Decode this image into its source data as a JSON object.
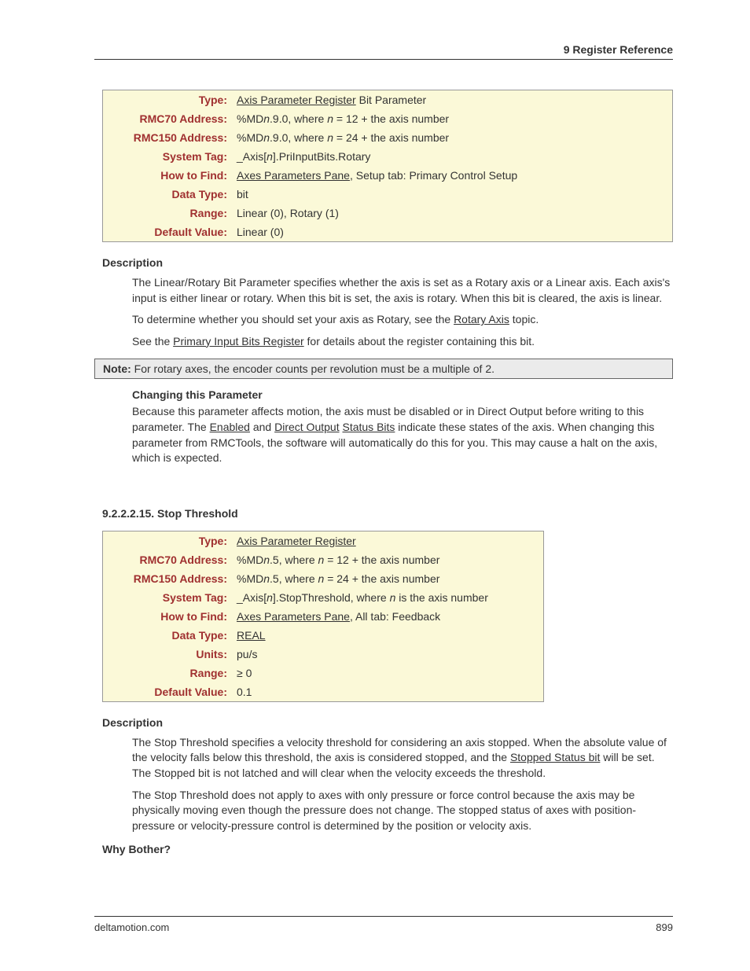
{
  "header": "9  Register Reference",
  "table1": {
    "type_label": "Type:",
    "type_link": "Axis Parameter Register",
    "type_suffix": " Bit Parameter",
    "rmc70_label": "RMC70 Address:",
    "rmc70_prefix": "%MD",
    "rmc70_n": "n",
    "rmc70_suffix1": ".9.0, where ",
    "rmc70_n2": "n",
    "rmc70_suffix2": " = 12 + the axis number",
    "rmc150_label": "RMC150 Address:",
    "rmc150_prefix": "%MD",
    "rmc150_n": "n",
    "rmc150_suffix1": ".9.0, where ",
    "rmc150_n2": "n",
    "rmc150_suffix2": " = 24 + the axis number",
    "systag_label": "System Tag:",
    "systag_prefix": "_Axis[",
    "systag_n": "n",
    "systag_suffix": "].PriInputBits.Rotary",
    "howto_label": "How to Find:",
    "howto_link": "Axes Parameters Pane",
    "howto_suffix": ", Setup tab: Primary Control Setup",
    "datatype_label": "Data Type:",
    "datatype_value": "bit",
    "range_label": "Range:",
    "range_value": "Linear (0), Rotary (1)",
    "default_label": "Default Value:",
    "default_value": "Linear (0)"
  },
  "desc1": {
    "heading": "Description",
    "p1": "The Linear/Rotary Bit Parameter specifies whether the axis is set as a Rotary axis or a Linear axis. Each axis's input is either linear or rotary. When this bit is set, the axis is rotary. When this bit is cleared, the axis is linear.",
    "p2_prefix": "To determine whether you should set your axis as Rotary, see the ",
    "p2_link": "Rotary Axis",
    "p2_suffix": " topic.",
    "p3_prefix": "See the ",
    "p3_link": "Primary Input Bits Register",
    "p3_suffix": " for details about the register containing this bit."
  },
  "note": {
    "bold": "Note:",
    "text": " For rotary axes, the encoder counts per revolution must be a multiple of 2."
  },
  "changing": {
    "heading": "Changing this Parameter",
    "p_prefix": "Because this parameter affects motion, the axis must be disabled or in Direct Output before writing to this parameter. The ",
    "link1": "Enabled",
    "mid1": " and ",
    "link2": "Direct Output",
    "mid2": " ",
    "link3": "Status Bits",
    "p_suffix": " indicate these states of the axis. When changing this parameter from RMCTools, the software will automatically do this for you. This may cause a halt on the axis, which is expected."
  },
  "section2": "9.2.2.2.15. Stop Threshold",
  "table2": {
    "type_label": "Type:",
    "type_link": "Axis Parameter Register",
    "rmc70_label": "RMC70 Address:",
    "rmc70_prefix": "%MD",
    "rmc70_n": "n",
    "rmc70_suffix1": ".5, where ",
    "rmc70_n2": "n",
    "rmc70_suffix2": " = 12 + the axis number",
    "rmc150_label": "RMC150 Address:",
    "rmc150_prefix": "%MD",
    "rmc150_n": "n",
    "rmc150_suffix1": ".5, where ",
    "rmc150_n2": "n",
    "rmc150_suffix2": " = 24 + the axis number",
    "systag_label": "System Tag:",
    "systag_prefix": "_Axis[",
    "systag_n": "n",
    "systag_mid": "].StopThreshold, where ",
    "systag_n2": "n",
    "systag_suffix": " is the axis number",
    "howto_label": "How to Find:",
    "howto_link": "Axes Parameters Pane",
    "howto_suffix": ", All tab: Feedback",
    "datatype_label": "Data Type:",
    "datatype_link": "REAL",
    "units_label": "Units:",
    "units_value": "pu/s",
    "range_label": "Range:",
    "range_value": "≥ 0",
    "default_label": "Default Value:",
    "default_value": "0.1"
  },
  "desc2": {
    "heading": "Description",
    "p1_prefix": "The Stop Threshold specifies a velocity threshold for considering an axis stopped. When the absolute value of the velocity falls below this threshold, the axis is considered stopped, and the ",
    "p1_link": "Stopped Status bit",
    "p1_suffix": " will be set. The Stopped bit is not latched and will clear when the velocity exceeds the threshold.",
    "p2": "The Stop Threshold does not apply to axes with only pressure or force control because the axis may be physically moving even though the pressure does not change. The stopped status of axes with position-pressure or velocity-pressure control is determined by the position or velocity axis."
  },
  "why": "Why Bother?",
  "footer_left": "deltamotion.com",
  "footer_right": "899"
}
